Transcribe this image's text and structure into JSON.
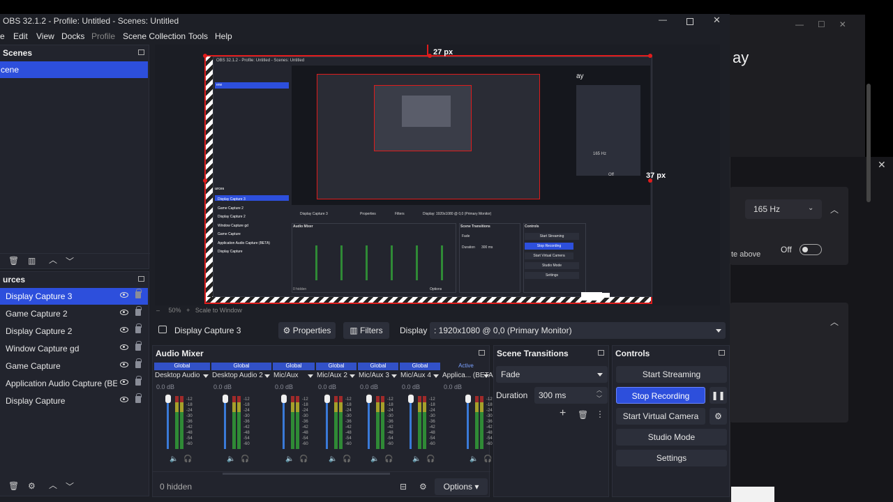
{
  "bg_window": {
    "title_fragment": "ay",
    "refresh_rate": "165 Hz",
    "toggle_label": "Off",
    "hint_fragment": "te above"
  },
  "window": {
    "title": "OBS 32.1.2 - Profile: Untitled - Scenes: Untitled"
  },
  "menu": {
    "items": [
      "e",
      "Edit",
      "View",
      "Docks",
      "Profile",
      "Scene Collection",
      "Tools",
      "Help"
    ]
  },
  "scenes": {
    "header": "Scenes",
    "items": [
      "cene"
    ]
  },
  "sources": {
    "header": "urces",
    "items": [
      {
        "label": "Display Capture 3",
        "selected": true
      },
      {
        "label": "Game Capture 2",
        "selected": false
      },
      {
        "label": "Display Capture 2",
        "selected": false
      },
      {
        "label": "Window Capture gd",
        "selected": false
      },
      {
        "label": "Game Capture",
        "selected": false
      },
      {
        "label": "Application Audio Capture (BET",
        "selected": false
      },
      {
        "label": "Display Capture",
        "selected": false
      }
    ]
  },
  "preview": {
    "top_measure": "27 px",
    "right_measure": "37 px"
  },
  "source_toolbar": {
    "source_name": "Display Capture 3",
    "properties": "Properties",
    "filters": "Filters",
    "display_label": "Display",
    "display_value": ": 1920x1080 @ 0,0 (Primary Monitor)"
  },
  "mixer": {
    "header": "Audio Mixer",
    "channels": [
      {
        "title": "Global",
        "name": "Desktop Audio",
        "db": "0.0 dB"
      },
      {
        "title": "Global",
        "name": "Desktop Audio 2",
        "db": "0.0 dB"
      },
      {
        "title": "Global",
        "name": "Mic/Aux",
        "db": "0.0 dB"
      },
      {
        "title": "Global",
        "name": "Mic/Aux 2",
        "db": "0.0 dB"
      },
      {
        "title": "Global",
        "name": "Mic/Aux 3",
        "db": "0.0 dB"
      },
      {
        "title": "Global",
        "name": "Mic/Aux 4",
        "db": "0.0 dB"
      },
      {
        "title": "Active",
        "name": "Applica... (BETA)",
        "db": "0.0 dB"
      }
    ],
    "scale": [
      "-12",
      "-18",
      "-24",
      "-30",
      "-36",
      "-42",
      "-48",
      "-54",
      "-60"
    ],
    "hidden_label": "0 hidden",
    "options_label": "Options"
  },
  "transitions": {
    "header": "Scene Transitions",
    "type": "Fade",
    "duration_label": "Duration",
    "duration_value": "300 ms"
  },
  "controls": {
    "header": "Controls",
    "start_streaming": "Start Streaming",
    "stop_recording": "Stop Recording",
    "start_virtual_camera": "Start Virtual Camera",
    "studio_mode": "Studio Mode",
    "settings": "Settings"
  },
  "nested": {
    "title": "OBS 32.1.2 - Profile: Untitled - Scenes: Untitled",
    "scene": "ene",
    "sources_header": "urces",
    "sources": [
      "Display Capture 3",
      "Game Capture 2",
      "Display Capture 2",
      "Window Capture gd",
      "Game Capture",
      "Application Audio Capture (BETA)",
      "Display Capture"
    ],
    "display_capture": "Display Capture 3",
    "mixer": "Audio Mixer",
    "transitions": "Scene Transitions",
    "controls": "Controls",
    "fade": "Fade",
    "duration": "Duration",
    "duration_value": "300 ms",
    "start_streaming": "Start Streaming",
    "stop_recording": "Stop Recording",
    "start_virtual_camera": "Start Virtual Camera",
    "studio_mode": "Studio Mode",
    "settings": "Settings",
    "zoom": "50%",
    "scale_to_window": "Scale to Window",
    "hidden": "0 hidden",
    "options": "Options",
    "properties": "Properties",
    "filters": "Filters",
    "display": "Display",
    "display_value": ": 1920x1080 @ 0,0 (Primary Monitor)",
    "hz": "165 Hz",
    "off": "Off",
    "bg_title_fragment": "ay"
  }
}
